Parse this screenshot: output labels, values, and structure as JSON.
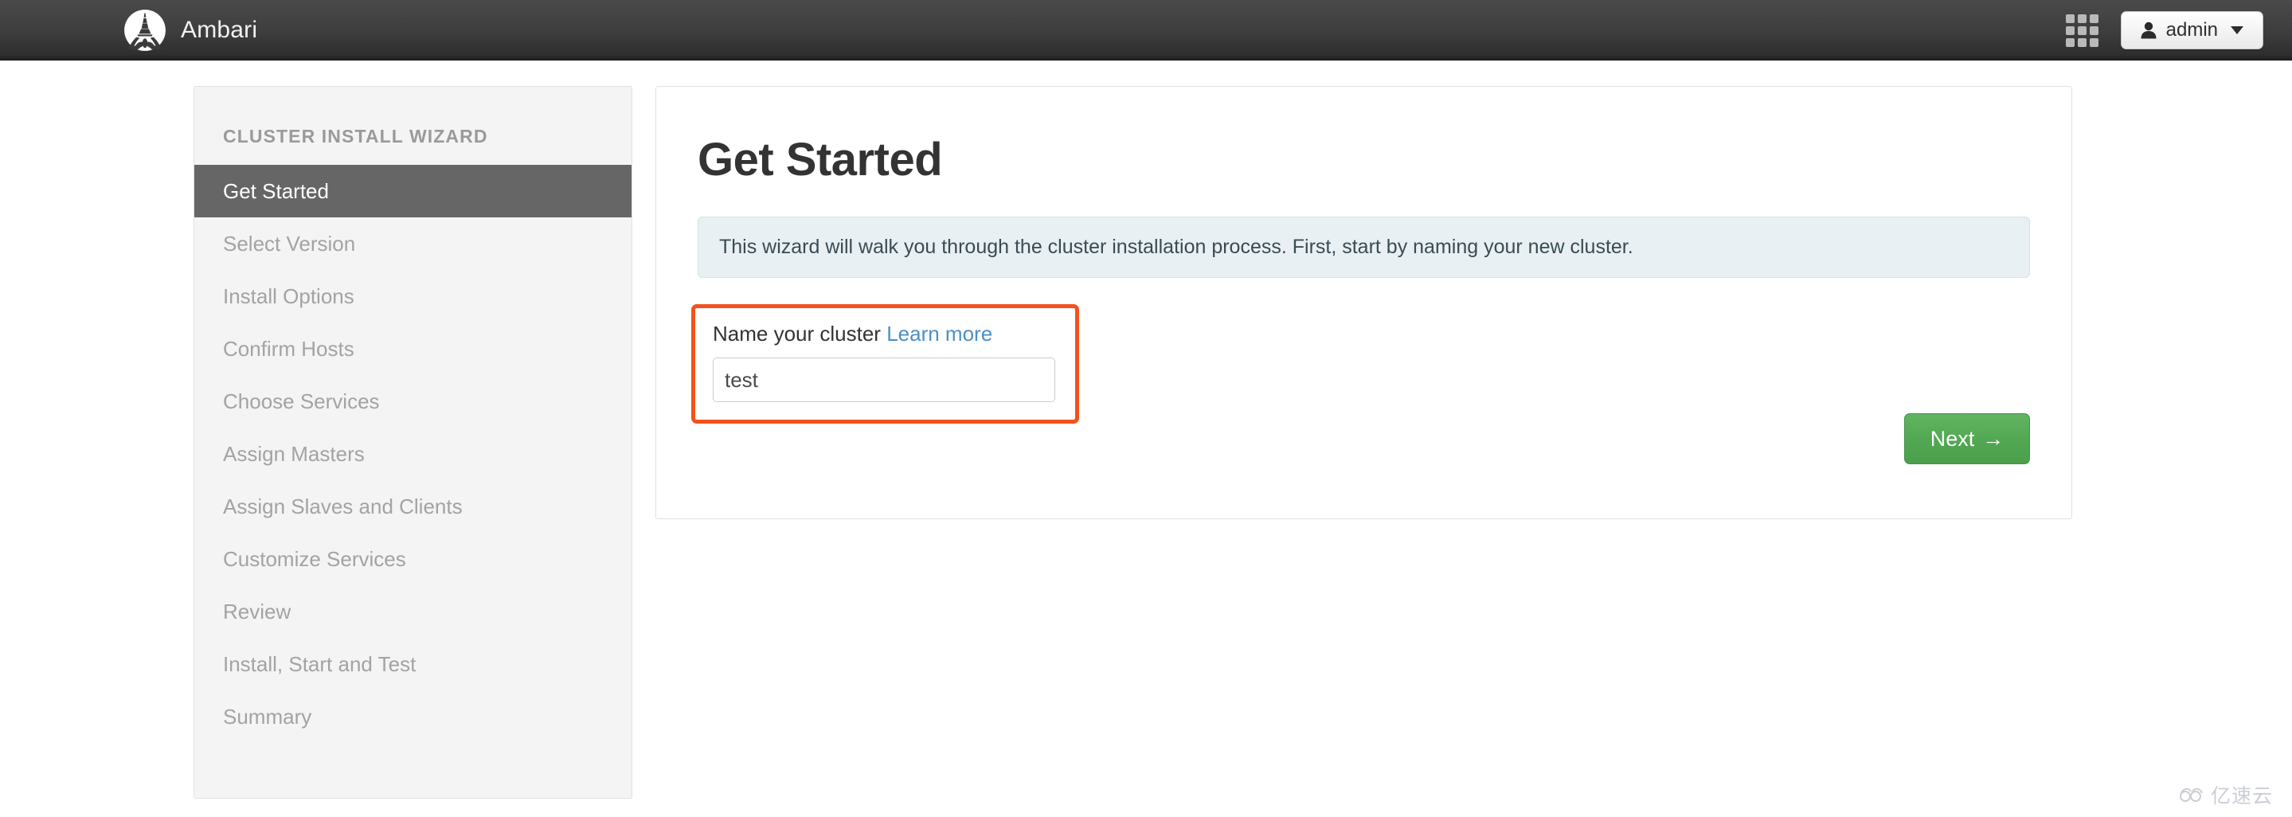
{
  "header": {
    "brand_title": "Ambari",
    "logo_icon": "ambari-pagoda-logo",
    "grid_icon": "grid-apps-icon",
    "user_icon": "user-person-icon",
    "user_label": "admin",
    "caret_icon": "chevron-down-icon"
  },
  "sidebar": {
    "heading": "CLUSTER INSTALL WIZARD",
    "items": [
      {
        "label": "Get Started",
        "active": true
      },
      {
        "label": "Select Version",
        "active": false
      },
      {
        "label": "Install Options",
        "active": false
      },
      {
        "label": "Confirm Hosts",
        "active": false
      },
      {
        "label": "Choose Services",
        "active": false
      },
      {
        "label": "Assign Masters",
        "active": false
      },
      {
        "label": "Assign Slaves and Clients",
        "active": false
      },
      {
        "label": "Customize Services",
        "active": false
      },
      {
        "label": "Review",
        "active": false
      },
      {
        "label": "Install, Start and Test",
        "active": false
      },
      {
        "label": "Summary",
        "active": false
      }
    ]
  },
  "main": {
    "title": "Get Started",
    "alert_text": "This wizard will walk you through the cluster installation process. First, start by naming your new cluster.",
    "field_label": "Name your cluster",
    "learn_more_label": "Learn more",
    "cluster_name_value": "test",
    "cluster_name_placeholder": "",
    "next_label": "Next",
    "next_arrow": "→"
  },
  "watermark": {
    "text": "亿速云",
    "icon": "cloud-icon"
  },
  "colors": {
    "header_dark": "#3d3d3d",
    "sidebar_bg": "#f4f4f4",
    "active_item_bg": "#666666",
    "alert_bg": "#e8f0f3",
    "highlight_border": "#f4511e",
    "link_blue": "#4a90c4",
    "next_green": "#53a853"
  }
}
